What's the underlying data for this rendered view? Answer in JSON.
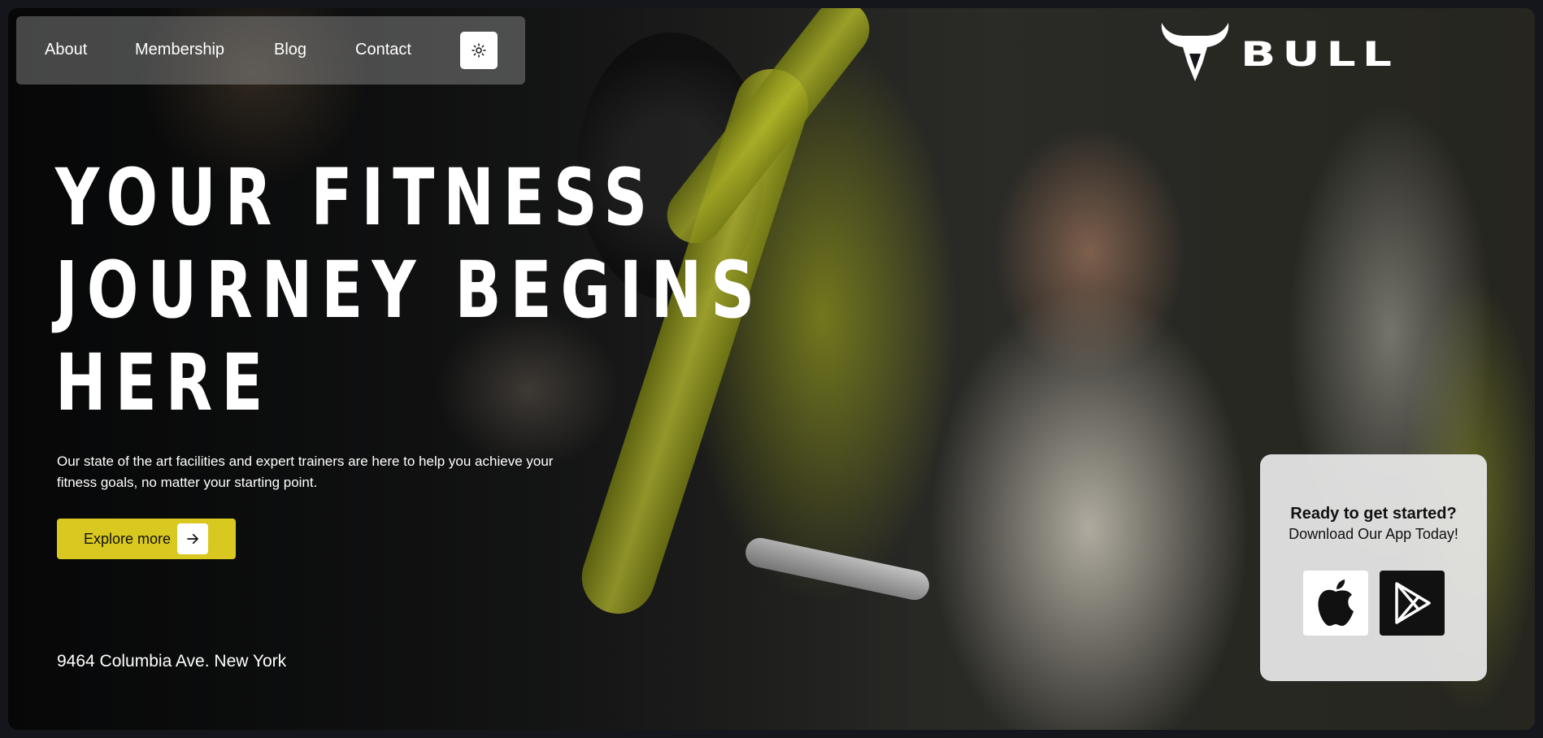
{
  "nav": {
    "links": [
      {
        "label": "About"
      },
      {
        "label": "Membership"
      },
      {
        "label": "Blog"
      },
      {
        "label": "Contact"
      }
    ],
    "theme_icon": "sun-icon"
  },
  "brand": {
    "name": "BULL",
    "logo_icon": "bull-head-icon"
  },
  "hero": {
    "headline_lines": [
      "YOUR FITNESS",
      "JOURNEY BEGINS",
      "HERE"
    ],
    "description": "Our state of the art facilities and expert trainers are here to help you achieve your fitness goals, no matter your starting point.",
    "cta_label": "Explore more",
    "cta_icon": "arrow-right-icon",
    "address": "9464 Columbia Ave. New York"
  },
  "app_card": {
    "title": "Ready to get started?",
    "subtitle": "Download Our App Today!",
    "stores": [
      {
        "icon": "apple-icon"
      },
      {
        "icon": "google-play-icon"
      }
    ]
  },
  "colors": {
    "accent": "#d8c81f",
    "background": "#15151c",
    "text": "#ffffff"
  }
}
